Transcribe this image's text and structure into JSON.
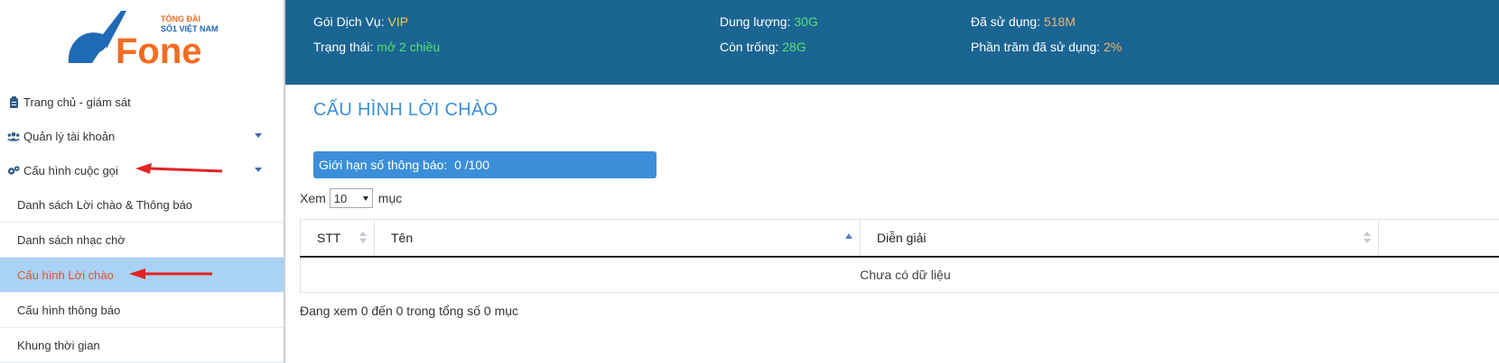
{
  "logo": {
    "brand": "Fone",
    "tagline_line1": "TỔNG ĐÀI",
    "tagline_line2": "SỐ1 VIỆT NAM"
  },
  "sidebar": {
    "items": [
      {
        "label": "Trang chủ - giám sát",
        "icon": "clipboard-icon"
      },
      {
        "label": "Quản lý tài khoản",
        "icon": "users-icon"
      },
      {
        "label": "Cấu hình cuộc gọi",
        "icon": "gears-icon"
      }
    ],
    "subitems": [
      {
        "label": "Danh sách Lời chào & Thông báo"
      },
      {
        "label": "Danh sách nhạc chờ"
      },
      {
        "label": "Cấu hình Lời chào",
        "active": true
      },
      {
        "label": "Cấu hình thông báo"
      },
      {
        "label": "Khung thời gian"
      }
    ]
  },
  "topbar": {
    "service_label": "Gói Dịch Vụ:",
    "service_value": "VIP",
    "status_label": "Trạng thái:",
    "status_value": "mở 2 chiều",
    "capacity_label": "Dung lượng:",
    "capacity_value": "30G",
    "free_label": "Còn trống:",
    "free_value": "28G",
    "used_label": "Đã sử dụng:",
    "used_value": "518M",
    "used_pct_label": "Phần trăm đã sử dụng:",
    "used_pct_value": "2%"
  },
  "main": {
    "title": "CẤU HÌNH LỜI CHÀO",
    "limit_label": "Giới hạn số thông báo:",
    "limit_value": "0",
    "limit_max": "/100",
    "show_prefix": "Xem",
    "page_size": "10",
    "show_suffix": "mục",
    "table": {
      "columns": [
        "STT",
        "Tên",
        "Diễn giải",
        ""
      ],
      "empty_text": "Chưa có dữ liệu"
    },
    "info": "Đang xem 0 đến 0 trong tổng số 0 mục"
  },
  "colors": {
    "topbar": "#1b6593",
    "accent": "#3b8fd9",
    "active_bg": "#a9d2f5",
    "active_text": "#e8502a"
  }
}
